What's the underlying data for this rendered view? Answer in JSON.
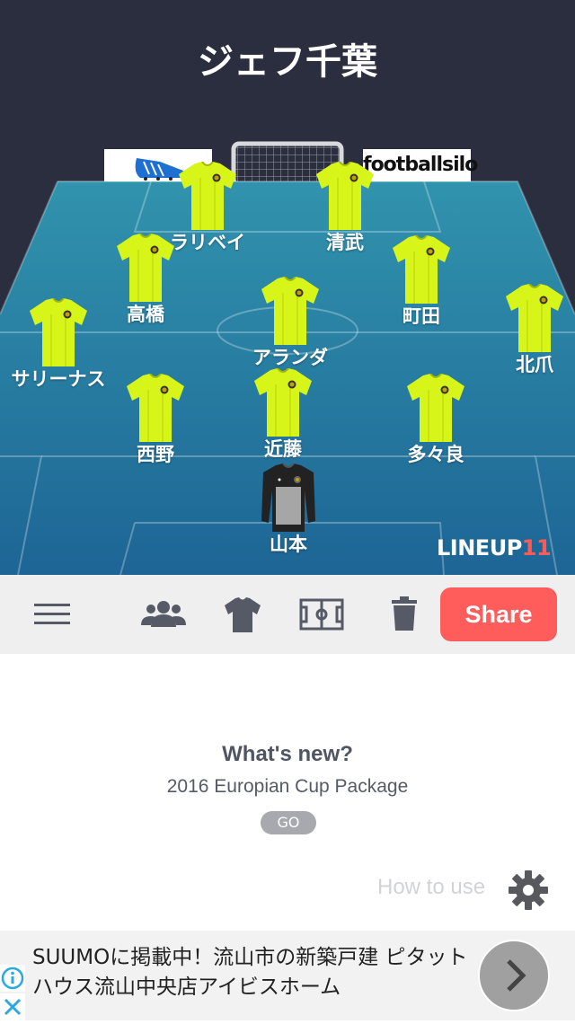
{
  "team": {
    "name": "ジェフ千葉"
  },
  "sponsors": {
    "right": "footballsilo"
  },
  "players": [
    {
      "name": "ラリベイ",
      "kit": "outfield"
    },
    {
      "name": "清武",
      "kit": "outfield"
    },
    {
      "name": "高橋",
      "kit": "outfield"
    },
    {
      "name": "町田",
      "kit": "outfield"
    },
    {
      "name": "アランダ",
      "kit": "outfield"
    },
    {
      "name": "サリーナス",
      "kit": "outfield"
    },
    {
      "name": "北爪",
      "kit": "outfield"
    },
    {
      "name": "西野",
      "kit": "outfield"
    },
    {
      "name": "近藤",
      "kit": "outfield"
    },
    {
      "name": "多々良",
      "kit": "outfield"
    },
    {
      "name": "山本",
      "kit": "goalkeeper"
    }
  ],
  "brand": {
    "text": "LINEUP",
    "number": "11"
  },
  "toolbar": {
    "menu_icon": "hamburger-menu-icon",
    "players_icon": "group-icon",
    "kit_icon": "shirt-icon",
    "formation_icon": "pitch-icon",
    "delete_icon": "trash-icon",
    "share_label": "Share"
  },
  "news": {
    "title": "What's new?",
    "subtitle": "2016 Europian Cup Package",
    "go_label": "GO"
  },
  "help": {
    "label": "How to use",
    "icon": "gear-icon"
  },
  "ad": {
    "text": "SUUMOに掲載中！流山市の新築戸建 ピタットハウス流山中央店アイビスホーム",
    "arrow_icon": "chevron-right-icon"
  },
  "colors": {
    "header_bg": "#2b2e3e",
    "pitch_top": "#2f8aa8",
    "pitch_bottom": "#1f6a98",
    "kit": "#d8f51a",
    "share": "#ff5c5c",
    "toolbar_bg": "#efeff0"
  }
}
